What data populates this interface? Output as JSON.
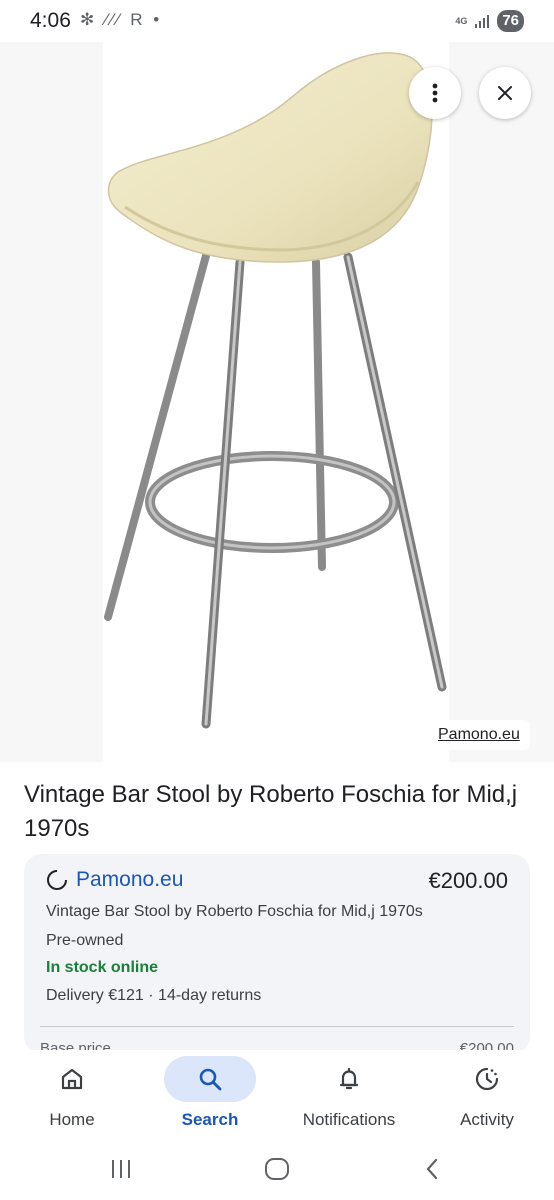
{
  "status_bar": {
    "time": "4:06",
    "left_icons": "✻ ⁄⁄⁄ R •",
    "network": "4G",
    "battery": "76"
  },
  "image_viewer": {
    "source_label": "Pamono.eu",
    "more_icon": "more-vert-icon",
    "close_icon": "close-icon"
  },
  "product": {
    "title": "Vintage Bar Stool by Roberto Foschia for Mid,j 1970s"
  },
  "offer": {
    "merchant": "Pamono.eu",
    "price": "€200.00",
    "description": "Vintage Bar Stool by Roberto Foschia for Mid,j 1970s",
    "condition": "Pre-owned",
    "stock": "In stock online",
    "delivery": "Delivery €121 · 14-day returns",
    "base_price_label": "Base price",
    "base_price_value": "€200.00"
  },
  "bottom_nav": {
    "items": [
      {
        "label": "Home",
        "icon": "home-icon"
      },
      {
        "label": "Search",
        "icon": "search-icon",
        "active": true
      },
      {
        "label": "Notifications",
        "icon": "bell-icon"
      },
      {
        "label": "Activity",
        "icon": "activity-icon"
      }
    ]
  },
  "colors": {
    "accent": "#1a57b8",
    "stock_green": "#188038",
    "active_pill": "#dbe6fa"
  }
}
